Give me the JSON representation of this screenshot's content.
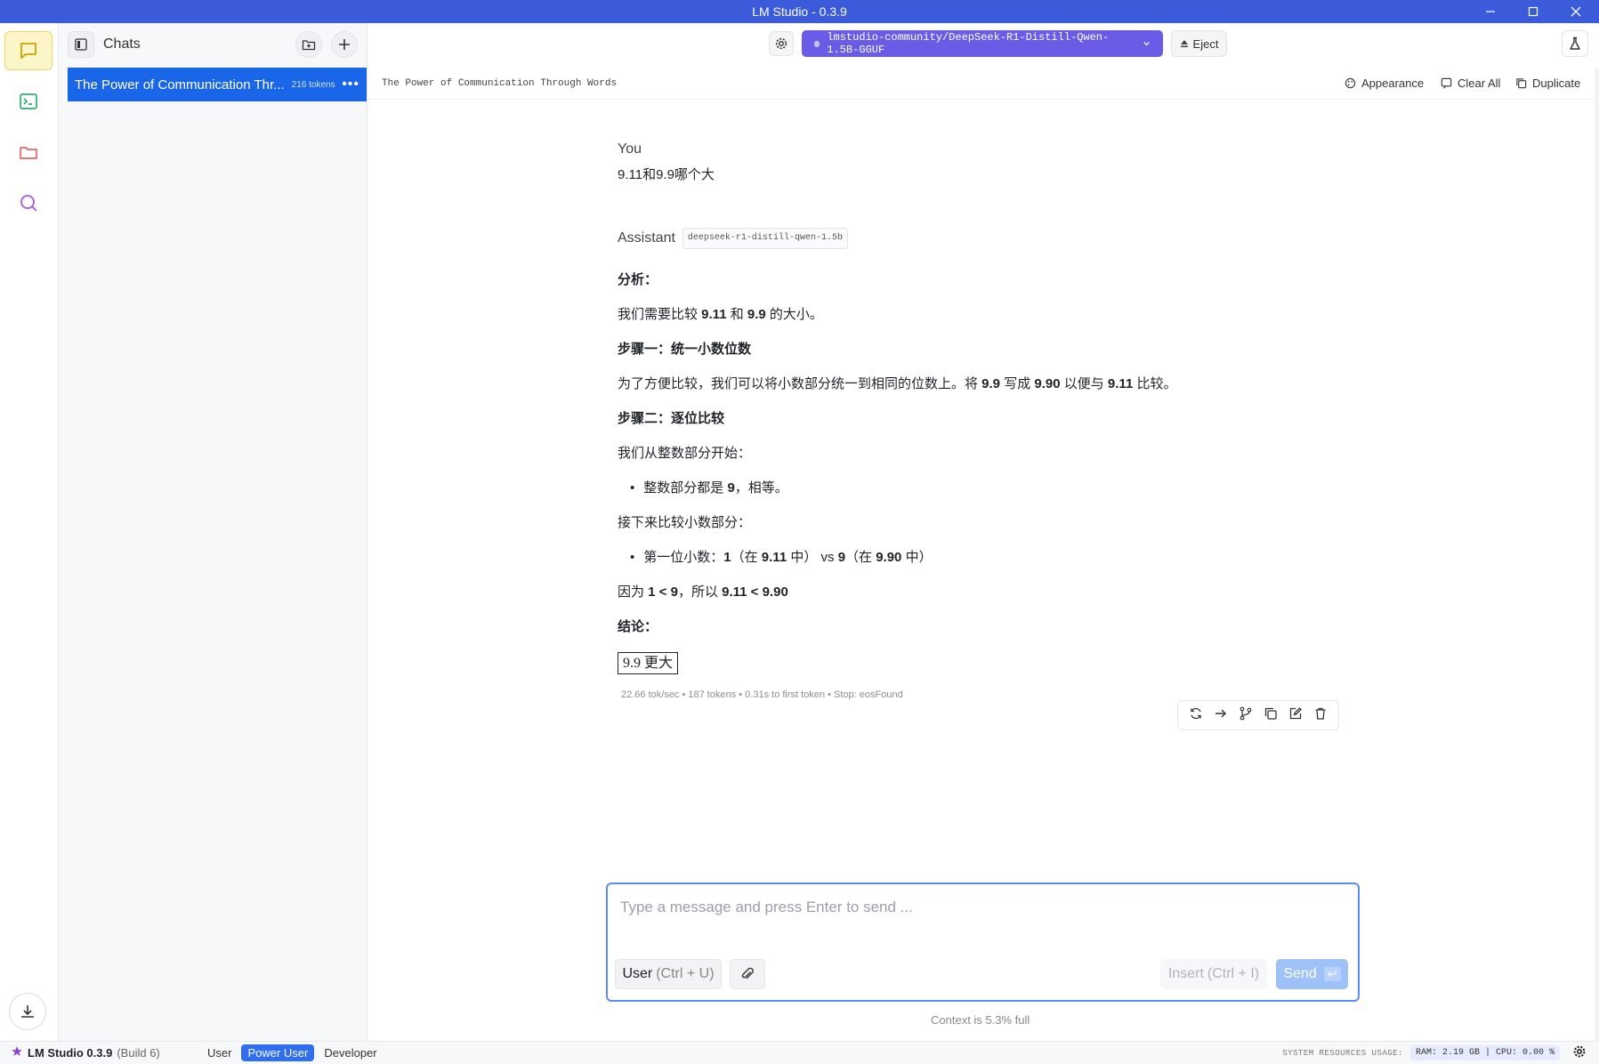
{
  "window": {
    "title": "LM Studio - 0.3.9"
  },
  "sidebar": {
    "title": "Chats",
    "chats": [
      {
        "title": "The Power of Communication Thr...",
        "tokens": "216 tokens"
      }
    ]
  },
  "topbar": {
    "model": "lmstudio-community/DeepSeek-R1-Distill-Qwen-1.5B-GGUF",
    "eject": "Eject"
  },
  "subbar": {
    "chat_title": "The Power of Communication Through Words",
    "appearance": "Appearance",
    "clear_all": "Clear All",
    "duplicate": "Duplicate"
  },
  "messages": {
    "user_role": "You",
    "user_text": "9.11和9.9哪个大",
    "assistant_role": "Assistant",
    "assistant_model": "deepseek-r1-distill-qwen-1.5b",
    "analysis": "分析：",
    "l1a": "我们需要比较 ",
    "l1b": "9.11",
    "l1c": " 和 ",
    "l1d": "9.9",
    "l1e": " 的大小。",
    "step1": "步骤一：统一小数位数",
    "l2a": "为了方便比较，我们可以将小数部分统一到相同的位数上。将 ",
    "l2b": "9.9",
    "l2c": " 写成 ",
    "l2d": "9.90",
    "l2e": " 以便与 ",
    "l2f": "9.11",
    "l2g": " 比较。",
    "step2": "步骤二：逐位比较",
    "l3": "我们从整数部分开始：",
    "b1a": "整数部分都是 ",
    "b1b": "9",
    "b1c": "，相等。",
    "l4": "接下来比较小数部分：",
    "b2a": "第一位小数：",
    "b2b": "1",
    "b2c": "（在 ",
    "b2d": "9.11",
    "b2e": " 中） vs ",
    "b2f": "9",
    "b2g": "（在 ",
    "b2h": "9.90",
    "b2i": " 中）",
    "l5a": "因为 ",
    "l5b": "1 < 9",
    "l5c": "，所以 ",
    "l5d": "9.11 < 9.90",
    "conclusion": "结论：",
    "answer": "9.9 更大",
    "stats": "22.66 tok/sec • 187 tokens • 0.31s to first token • Stop: eosFound"
  },
  "composer": {
    "placeholder": "Type a message and press Enter to send ...",
    "role_btn": "User",
    "role_hint": "(Ctrl + U)",
    "insert_btn": "Insert",
    "insert_hint": "(Ctrl + I)",
    "send_btn": "Send",
    "context": "Context is 5.3% full"
  },
  "statusbar": {
    "app": "LM Studio 0.3.9",
    "build": "(Build 6)",
    "modes": [
      "User",
      "Power User",
      "Developer"
    ],
    "active_mode": "Power User",
    "sys_label": "SYSTEM RESOURCES USAGE:",
    "ram": "RAM: 2.19 GB",
    "cpu": "CPU: 0.00 %"
  },
  "colors": {
    "titlebar": "#3b5bdb",
    "model_pill": "#6b5ce7",
    "selected_chat": "#1a66e8",
    "composer_border": "#5b8def"
  }
}
